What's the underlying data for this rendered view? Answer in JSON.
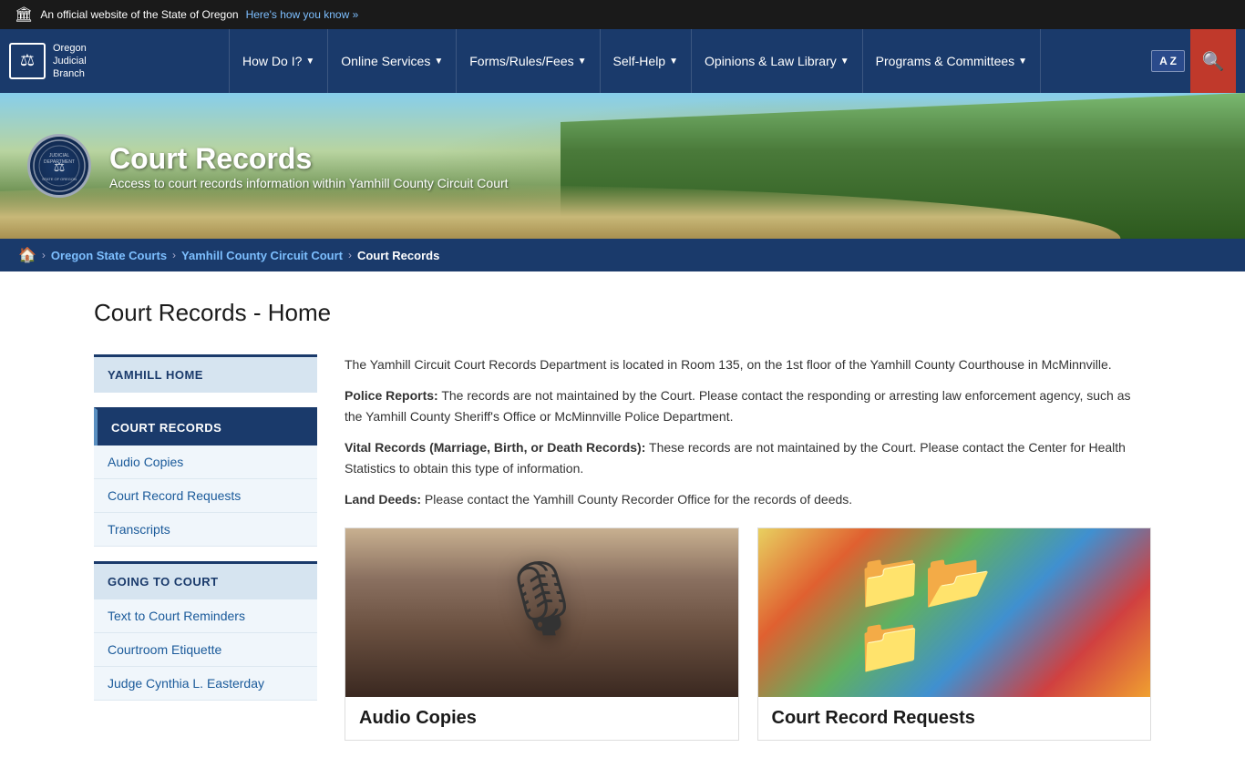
{
  "topBanner": {
    "flag": "🏛",
    "text": "An official website of the State of Oregon",
    "linkText": "Here's how you know »"
  },
  "nav": {
    "logoLine1": "Oregon",
    "logoLine2": "Judicial",
    "logoLine3": "Branch",
    "logoIcon": "⚖",
    "items": [
      {
        "id": "how-do-i",
        "label": "How Do I?",
        "hasDropdown": true
      },
      {
        "id": "online-services",
        "label": "Online Services",
        "hasDropdown": true
      },
      {
        "id": "forms-rules-fees",
        "label": "Forms/Rules/Fees",
        "hasDropdown": true
      },
      {
        "id": "self-help",
        "label": "Self-Help",
        "hasDropdown": true
      },
      {
        "id": "opinions-law-library",
        "label": "Opinions & Law Library",
        "hasDropdown": true
      },
      {
        "id": "programs-committees",
        "label": "Programs & Committees",
        "hasDropdown": true
      }
    ],
    "translateLabel": "A Z",
    "searchIcon": "🔍"
  },
  "hero": {
    "title": "Court Records",
    "subtitle": "Access to court records information within Yamhill County Circuit Court",
    "sealAlt": "Judicial Department State of Oregon"
  },
  "breadcrumb": {
    "homeIcon": "🏠",
    "items": [
      {
        "label": "Oregon State Courts",
        "link": true
      },
      {
        "label": "Yamhill County Circuit Court",
        "link": true
      },
      {
        "label": "Court Records",
        "link": false
      }
    ]
  },
  "pageTitle": "Court Records - Home",
  "sidebar": {
    "sections": [
      {
        "id": "yamhill-home",
        "heading": "YAMHILL HOME",
        "isActive": false,
        "links": []
      },
      {
        "id": "court-records",
        "heading": "COURT RECORDS",
        "isActive": true,
        "links": [
          {
            "label": "Audio Copies",
            "href": "#"
          },
          {
            "label": "Court Record Requests",
            "href": "#"
          },
          {
            "label": "Transcripts",
            "href": "#"
          }
        ]
      },
      {
        "id": "going-to-court",
        "heading": "GOING TO COURT",
        "isActive": false,
        "links": [
          {
            "label": "Text to Court Reminders",
            "href": "#"
          },
          {
            "label": "Courtroom Etiquette",
            "href": "#"
          },
          {
            "label": "Judge Cynthia L. Easterday",
            "href": "#"
          }
        ]
      }
    ]
  },
  "mainContent": {
    "intro": "The Yamhill Circuit Court Records Department is located in Room 135, on the 1st floor of the Yamhill County Courthouse in McMinnville.",
    "policeLabel": "Police Reports:",
    "policeText": " The records are not maintained by the Court. Please contact the responding or arresting law enforcement agency, such as the Yamhill County Sheriff's Office or McMinnville Police Department.",
    "vitalLabel": "Vital Records (Marriage, Birth, or Death Records):",
    "vitalText": " These records are not maintained by the Court. Please contact the Center for Health Statistics to obtain this type of information.",
    "landLabel": "Land Deeds:",
    "landText": " Please contact the Yamhill County Recorder Office for the records of deeds.",
    "cards": [
      {
        "id": "audio-copies",
        "title": "Audio Copies",
        "imgType": "microphone"
      },
      {
        "id": "court-record-requests",
        "title": "Court Record Requests",
        "imgType": "folders"
      }
    ]
  }
}
